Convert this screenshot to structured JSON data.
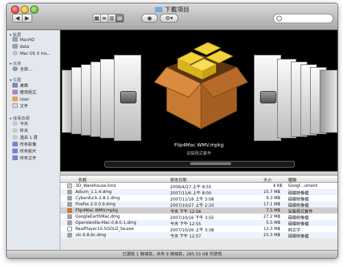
{
  "window": {
    "title": "下載項目"
  },
  "sidebar": {
    "sections": [
      {
        "label": "裝置",
        "items": [
          {
            "label": "MacHD"
          },
          {
            "label": "data"
          },
          {
            "label": "Mac OS X Ins..."
          }
        ]
      },
      {
        "label": "共享",
        "items": [
          {
            "label": "全部..."
          }
        ]
      },
      {
        "label": "位置",
        "items": [
          {
            "label": "桌面"
          },
          {
            "label": "應用程式"
          },
          {
            "label": "User"
          },
          {
            "label": "文件"
          }
        ]
      },
      {
        "label": "搜尋目標",
        "items": [
          {
            "label": "今天"
          },
          {
            "label": "昨天"
          },
          {
            "label": "過去 1 週"
          },
          {
            "label": "所有影像"
          },
          {
            "label": "所有影片"
          },
          {
            "label": "所有文件"
          }
        ]
      }
    ]
  },
  "coverflow": {
    "selected_name": "Flip4Mac WMV.mpkg",
    "selected_kind": "安裝程式套件"
  },
  "list": {
    "columns": {
      "name": "名稱",
      "date": "修改日期",
      "size": "大小",
      "kind": "種類"
    },
    "rows": [
      {
        "name": "3D_Warehouse.kmz",
        "date": "2006/4/27 上午 8:55",
        "size": "4 KB",
        "kind": "Googl...ument"
      },
      {
        "name": "Adium_1.1.4.dmg",
        "date": "2007/11/6 上午 8:00",
        "size": "15.7 MB",
        "kind": "磁碟映像檔"
      },
      {
        "name": "Cyberduck-2.8.1.dmg",
        "date": "2007/11/18 上午 3:08",
        "size": "9.3 MB",
        "kind": "磁碟映像檔"
      },
      {
        "name": "Firefox 2.0.0.9.dmg",
        "date": "2007/10/27 上午 2:33",
        "size": "17.1 MB",
        "kind": "磁碟映像檔"
      },
      {
        "name": "Flip4Mac WMV.mpkg",
        "date": "今天 下午 12:56",
        "size": "7.5 MB",
        "kind": "安裝程式套件"
      },
      {
        "name": "GoogleEarthMac.dmg",
        "date": "2007/10/16 下午 3:55",
        "size": "27.2 MB",
        "kind": "磁碟映像檔"
      },
      {
        "name": "OpenVanilla-Mac-0.8.0.1.dmg",
        "date": "今天 下午 12:55",
        "size": "5.5 MB",
        "kind": "磁碟映像檔"
      },
      {
        "name": "RealPlayer10-5GOLD_tw.exe",
        "date": "2007/10/26 上午 3:38",
        "size": "13.3 MB",
        "kind": "純文字"
      },
      {
        "name": "vlc-0.8.6c.dmg",
        "date": "今天 下午 12:57",
        "size": "23.3 MB",
        "kind": "磁碟映像檔"
      }
    ]
  },
  "status": {
    "text": "已選取 1 個項目，共有 9 個項目，285.53 GB 可使用"
  }
}
